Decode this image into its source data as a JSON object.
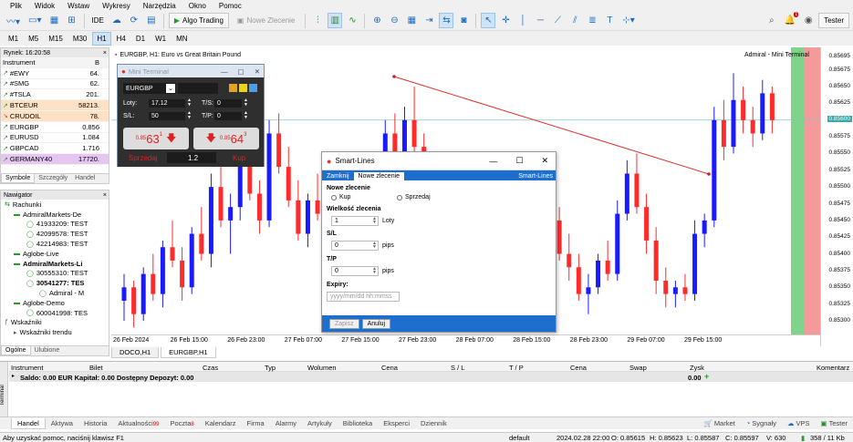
{
  "menu": [
    "Plik",
    "Widok",
    "Wstaw",
    "Wykresy",
    "Narzędzia",
    "Okno",
    "Pomoc"
  ],
  "toolbar": {
    "ide": "IDE",
    "algo": "Algo Trading",
    "new_order": "Nowe Zlecenie",
    "notif_count": "1",
    "tester": "Tester"
  },
  "timeframes": [
    "M1",
    "M5",
    "M15",
    "M30",
    "H1",
    "H4",
    "D1",
    "W1",
    "MN"
  ],
  "active_timeframe": "H1",
  "market_watch": {
    "title": "Rynek: 16:20:58",
    "col_instrument": "Instrument",
    "col_b": "B",
    "rows": [
      {
        "sym": "#EWY",
        "val": "64.",
        "dir": "up",
        "bg": "#ffffff"
      },
      {
        "sym": "#SMG",
        "val": "62.",
        "dir": "up",
        "bg": "#ffffff"
      },
      {
        "sym": "#TSLA",
        "val": "201.",
        "dir": "up",
        "bg": "#ffffff"
      },
      {
        "sym": "BTCEUR",
        "val": "58213.",
        "dir": "up",
        "bg": "#ffe2c6"
      },
      {
        "sym": "CRUDOIL",
        "val": "78.",
        "dir": "down",
        "bg": "#ffe2c6"
      },
      {
        "sym": "EURGBP",
        "val": "0.856",
        "dir": "up",
        "bg": "#ffffff"
      },
      {
        "sym": "EURUSD",
        "val": "1.084",
        "dir": "up",
        "bg": "#ffffff"
      },
      {
        "sym": "GBPCAD",
        "val": "1.716",
        "dir": "up",
        "bg": "#ffffff"
      },
      {
        "sym": "GERMANY40",
        "val": "17720.",
        "dir": "up",
        "bg": "#e4c6f0"
      }
    ],
    "tabs": [
      "Symbole",
      "Szczegóły",
      "Handel"
    ]
  },
  "navigator": {
    "title": "Nawigator",
    "rows": [
      {
        "text": "Rachunki",
        "indent": 4,
        "bold": false,
        "icon": "accounts-icon"
      },
      {
        "text": "AdmiralMarkets-De",
        "indent": 14,
        "bold": false,
        "icon": "server-icon"
      },
      {
        "text": "41933209: TEST",
        "indent": 28,
        "bold": false,
        "icon": "user-icon"
      },
      {
        "text": "42099578: TEST",
        "indent": 28,
        "bold": false,
        "icon": "user-icon"
      },
      {
        "text": "42214983: TEST",
        "indent": 28,
        "bold": false,
        "icon": "user-icon"
      },
      {
        "text": "Aglobe-Live",
        "indent": 14,
        "bold": false,
        "icon": "server-icon"
      },
      {
        "text": "AdmiralMarkets-Li",
        "indent": 14,
        "bold": true,
        "icon": "server-icon"
      },
      {
        "text": "30555310: TEST",
        "indent": 28,
        "bold": false,
        "icon": "user-icon"
      },
      {
        "text": "30541277: TES",
        "indent": 28,
        "bold": true,
        "icon": "user-icon"
      },
      {
        "text": "Admiral - M",
        "indent": 42,
        "bold": false,
        "icon": "user-icon"
      },
      {
        "text": "Aglobe-Demo",
        "indent": 14,
        "bold": false,
        "icon": "server-icon"
      },
      {
        "text": "600041998: TES",
        "indent": 28,
        "bold": false,
        "icon": "user-icon"
      },
      {
        "text": "Wskaźniki",
        "indent": 4,
        "bold": false,
        "icon": "indicators-icon"
      },
      {
        "text": "Wskaźniki trendu",
        "indent": 14,
        "bold": false,
        "icon": "folder-icon"
      }
    ],
    "tabs": [
      "Ogólne",
      "Ulubione"
    ]
  },
  "chart": {
    "title": "EURGBP, H1:  Euro vs Great Britain Pound",
    "right_label": "Admiral - Mini Terminal",
    "tabs": [
      "DOCO,H1",
      "EURGBP,H1"
    ],
    "active_tab": "EURGBP,H1",
    "current_price": "0.85600",
    "trend_line_color": "#e03030"
  },
  "chart_data": {
    "type": "candlestick",
    "y_ticks": [
      "0.85695",
      "0.85675",
      "0.85650",
      "0.85625",
      "0.85600",
      "0.85575",
      "0.85550",
      "0.85525",
      "0.85500",
      "0.85475",
      "0.85450",
      "0.85425",
      "0.85400",
      "0.85375",
      "0.85350",
      "0.85325",
      "0.85300"
    ],
    "x_ticks": [
      "26 Feb 2024",
      "26 Feb 15:00",
      "26 Feb 23:00",
      "27 Feb 07:00",
      "27 Feb 15:00",
      "27 Feb 23:00",
      "28 Feb 07:00",
      "28 Feb 15:00",
      "28 Feb 23:00",
      "29 Feb 07:00",
      "29 Feb 15:00"
    ],
    "up_color": "#1a1aff",
    "down_color": "#ff2b2b",
    "ylim": [
      0.8529,
      0.857
    ],
    "candles": [
      [
        0.8533,
        0.8537,
        0.853,
        0.8535
      ],
      [
        0.8535,
        0.8536,
        0.8529,
        0.8531
      ],
      [
        0.8531,
        0.8538,
        0.853,
        0.8537
      ],
      [
        0.8537,
        0.854,
        0.8533,
        0.8534
      ],
      [
        0.8534,
        0.8542,
        0.8532,
        0.8541
      ],
      [
        0.8541,
        0.8545,
        0.8538,
        0.8539
      ],
      [
        0.8539,
        0.8541,
        0.8533,
        0.8535
      ],
      [
        0.8535,
        0.8544,
        0.8534,
        0.8543
      ],
      [
        0.8543,
        0.8547,
        0.8539,
        0.854
      ],
      [
        0.854,
        0.8552,
        0.8538,
        0.855
      ],
      [
        0.855,
        0.8553,
        0.8544,
        0.8545
      ],
      [
        0.8545,
        0.8549,
        0.854,
        0.8547
      ],
      [
        0.8547,
        0.8556,
        0.8545,
        0.8554
      ],
      [
        0.8554,
        0.8557,
        0.8548,
        0.8549
      ],
      [
        0.8549,
        0.8551,
        0.8543,
        0.8545
      ],
      [
        0.8545,
        0.856,
        0.8544,
        0.8558
      ],
      [
        0.8558,
        0.8561,
        0.8552,
        0.8553
      ],
      [
        0.8553,
        0.8556,
        0.8547,
        0.8548
      ],
      [
        0.8548,
        0.8551,
        0.8542,
        0.8543
      ],
      [
        0.8543,
        0.8549,
        0.8541,
        0.8548
      ],
      [
        0.8548,
        0.8552,
        0.8545,
        0.8546
      ],
      [
        0.8546,
        0.8548,
        0.8539,
        0.8541
      ],
      [
        0.8541,
        0.8545,
        0.8538,
        0.8543
      ],
      [
        0.8543,
        0.8546,
        0.8538,
        0.8539
      ],
      [
        0.8539,
        0.8541,
        0.8533,
        0.8535
      ],
      [
        0.8535,
        0.8544,
        0.8533,
        0.8542
      ],
      [
        0.8542,
        0.8547,
        0.854,
        0.8545
      ],
      [
        0.8545,
        0.856,
        0.8543,
        0.8558
      ],
      [
        0.8558,
        0.8561,
        0.8552,
        0.8553
      ],
      [
        0.8553,
        0.8562,
        0.8551,
        0.856
      ],
      [
        0.856,
        0.8565,
        0.8555,
        0.8556
      ],
      [
        0.8556,
        0.8558,
        0.8548,
        0.8549
      ],
      [
        0.8549,
        0.8552,
        0.8544,
        0.8545
      ],
      [
        0.8545,
        0.855,
        0.854,
        0.8548
      ],
      [
        0.8548,
        0.8551,
        0.8542,
        0.8544
      ],
      [
        0.8544,
        0.8547,
        0.8538,
        0.854
      ],
      [
        0.854,
        0.8543,
        0.8535,
        0.8537
      ],
      [
        0.8537,
        0.8545,
        0.8536,
        0.8543
      ],
      [
        0.8543,
        0.8546,
        0.854,
        0.8541
      ],
      [
        0.8541,
        0.8543,
        0.8532,
        0.8534
      ],
      [
        0.8534,
        0.8542,
        0.8532,
        0.854
      ],
      [
        0.854,
        0.8544,
        0.8538,
        0.8542
      ],
      [
        0.8542,
        0.8546,
        0.854,
        0.8541
      ],
      [
        0.8541,
        0.855,
        0.8539,
        0.8548
      ],
      [
        0.8548,
        0.8552,
        0.8544,
        0.8545
      ],
      [
        0.8545,
        0.8547,
        0.8539,
        0.854
      ],
      [
        0.854,
        0.8543,
        0.8536,
        0.8538
      ],
      [
        0.8538,
        0.854,
        0.8533,
        0.8534
      ],
      [
        0.8534,
        0.8537,
        0.8531,
        0.8535
      ],
      [
        0.8535,
        0.854,
        0.8534,
        0.8539
      ],
      [
        0.8539,
        0.8542,
        0.8536,
        0.8537
      ],
      [
        0.8537,
        0.8548,
        0.8536,
        0.8546
      ],
      [
        0.8546,
        0.8554,
        0.8545,
        0.8552
      ],
      [
        0.8552,
        0.8555,
        0.8546,
        0.8547
      ],
      [
        0.8547,
        0.8549,
        0.854,
        0.8542
      ],
      [
        0.8542,
        0.8544,
        0.8534,
        0.8536
      ],
      [
        0.8536,
        0.8538,
        0.8532,
        0.8534
      ],
      [
        0.8534,
        0.8536,
        0.8532,
        0.8535
      ],
      [
        0.8535,
        0.8537,
        0.8533,
        0.8534
      ],
      [
        0.8534,
        0.8545,
        0.8533,
        0.8543
      ],
      [
        0.8543,
        0.8546,
        0.8541,
        0.8545
      ],
      [
        0.8545,
        0.8562,
        0.8544,
        0.856
      ],
      [
        0.856,
        0.8563,
        0.8554,
        0.8556
      ],
      [
        0.8556,
        0.8567,
        0.8555,
        0.8563
      ],
      [
        0.8563,
        0.8565,
        0.8558,
        0.856
      ],
      [
        0.856,
        0.8562,
        0.8556,
        0.8558
      ],
      [
        0.8558,
        0.8566,
        0.8557,
        0.8564
      ],
      [
        0.8564,
        0.8565,
        0.8558,
        0.856
      ]
    ]
  },
  "mini_terminal": {
    "title": "Mini Terminal",
    "symbol": "EURGBP",
    "lots_label": "Loty:",
    "lots": "17.12",
    "sl_label": "S/L:",
    "sl": "50",
    "ts_label": "T/S:",
    "ts": "0",
    "tp_label": "T/P:",
    "tp": "0",
    "sell_price_small": "0.85",
    "sell_price_big": "63",
    "sell_price_sup": "1",
    "buy_price_small": "0.85",
    "buy_price_big": "64",
    "buy_price_sup": "3",
    "sell_label": "Sprzedaj",
    "spread": "1.2",
    "buy_label": "Kup"
  },
  "smart_lines": {
    "title": "Smart-Lines",
    "tabs": [
      "Zamknij",
      "Nowe zlecenie"
    ],
    "active_tab": "Nowe zlecenie",
    "brand": "Smart-Lines",
    "new_order_label": "Nowe zlecenie",
    "buy_option": "Kup",
    "sell_option": "Sprzedaj",
    "order_size_label": "Wielkość zlecenia",
    "lots_value": "1",
    "lots_unit": "Loty",
    "sl_label": "S/L",
    "sl_value": "0",
    "tp_label": "T/P",
    "tp_value": "0",
    "pips": "pips",
    "expiry_label": "Expiry:",
    "expiry_placeholder": "yyyy/mm/dd hh:mmss",
    "save": "Zapisz",
    "cancel": "Anuluj"
  },
  "terminal": {
    "side_label": "Terminal",
    "headers": [
      "Instrument",
      "Bilet",
      "Czas",
      "Typ",
      "Wolumen",
      "Cena",
      "S / L",
      "T / P",
      "Cena",
      "Swap",
      "Zysk",
      "Komentarz"
    ],
    "saldo": "Saldo: 0.00 EUR  Kapitał: 0.00  Dostępny Depozyt: 0.00",
    "profit": "0.00",
    "tabs": [
      {
        "label": "Handel",
        "badge": ""
      },
      {
        "label": "Aktywa",
        "badge": ""
      },
      {
        "label": "Historia",
        "badge": ""
      },
      {
        "label": "Aktualności",
        "badge": "99"
      },
      {
        "label": "Poczta",
        "badge": "8"
      },
      {
        "label": "Kalendarz",
        "badge": ""
      },
      {
        "label": "Firma",
        "badge": ""
      },
      {
        "label": "Alarmy",
        "badge": ""
      },
      {
        "label": "Artykuły",
        "badge": ""
      },
      {
        "label": "Biblioteka",
        "badge": ""
      },
      {
        "label": "Eksperci",
        "badge": ""
      },
      {
        "label": "Dziennik",
        "badge": ""
      }
    ],
    "right_tabs": [
      "Market",
      "Sygnały",
      "VPS",
      "Tester"
    ]
  },
  "status": {
    "help": "Aby uzyskać pomoc, naciśnij klawisz F1",
    "profile": "default",
    "datetime": "2024.02.28 22:00",
    "o": "O: 0.85615",
    "h": "H: 0.85623",
    "l": "L: 0.85587",
    "c": "C: 0.85597",
    "v": "V: 630",
    "traffic": "358 / 11 Kb"
  }
}
